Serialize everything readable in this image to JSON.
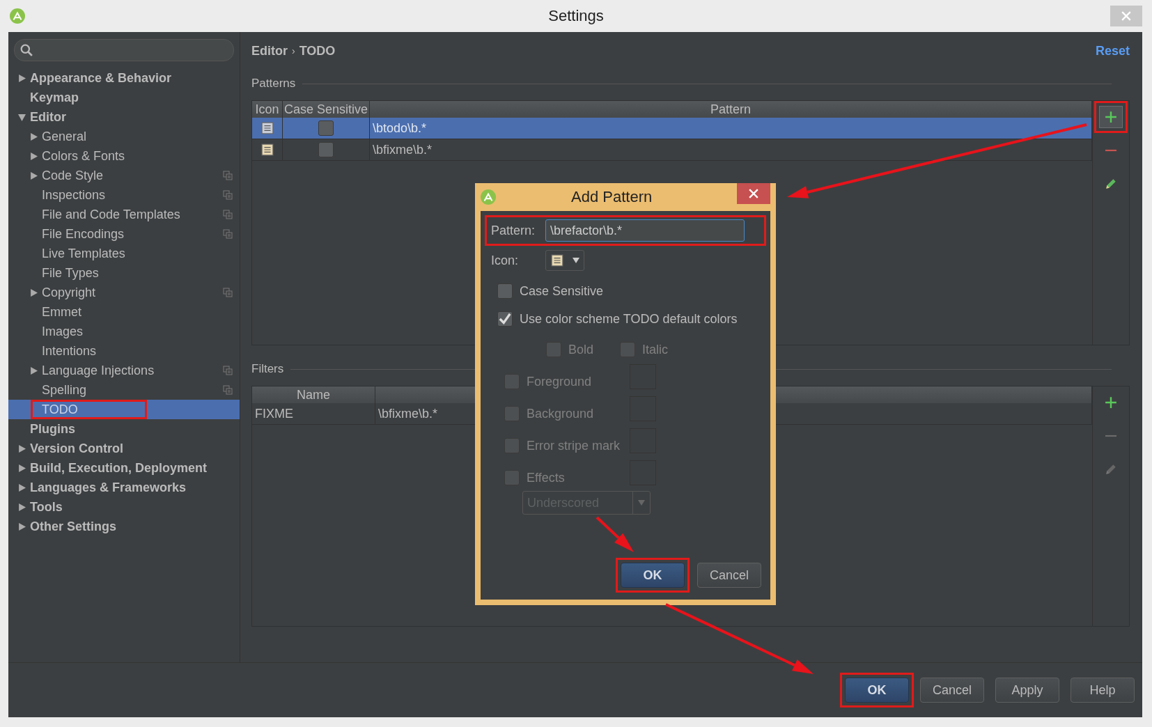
{
  "window": {
    "title": "Settings"
  },
  "sidebar": {
    "items": [
      {
        "label": "Appearance & Behavior",
        "expanded": false
      },
      {
        "label": "Keymap"
      },
      {
        "label": "Editor",
        "expanded": true,
        "children": [
          {
            "label": "General",
            "expanded": false,
            "project_level": false,
            "selected": false,
            "highlighted": false
          },
          {
            "label": "Colors & Fonts",
            "expanded": false,
            "project_level": false,
            "selected": false,
            "highlighted": false
          },
          {
            "label": "Code Style",
            "expanded": false,
            "project_level": true,
            "selected": false,
            "highlighted": false
          },
          {
            "label": "Inspections",
            "project_level": true,
            "selected": false,
            "highlighted": false
          },
          {
            "label": "File and Code Templates",
            "project_level": true,
            "selected": false,
            "highlighted": false
          },
          {
            "label": "File Encodings",
            "project_level": true,
            "selected": false,
            "highlighted": false
          },
          {
            "label": "Live Templates",
            "project_level": false,
            "selected": false,
            "highlighted": false
          },
          {
            "label": "File Types",
            "project_level": false,
            "selected": false,
            "highlighted": false
          },
          {
            "label": "Copyright",
            "expanded": false,
            "project_level": true,
            "selected": false,
            "highlighted": false
          },
          {
            "label": "Emmet",
            "project_level": false,
            "selected": false,
            "highlighted": false
          },
          {
            "label": "Images",
            "project_level": false,
            "selected": false,
            "highlighted": false
          },
          {
            "label": "Intentions",
            "project_level": false,
            "selected": false,
            "highlighted": false
          },
          {
            "label": "Language Injections",
            "expanded": false,
            "project_level": true,
            "selected": false,
            "highlighted": false
          },
          {
            "label": "Spelling",
            "project_level": true,
            "selected": false,
            "highlighted": false
          },
          {
            "label": "TODO",
            "project_level": false,
            "selected": true,
            "highlighted": true
          }
        ]
      },
      {
        "label": "Plugins"
      },
      {
        "label": "Version Control",
        "expanded": false
      },
      {
        "label": "Build, Execution, Deployment",
        "expanded": false
      },
      {
        "label": "Languages & Frameworks",
        "expanded": false
      },
      {
        "label": "Tools",
        "expanded": false
      },
      {
        "label": "Other Settings",
        "expanded": false
      }
    ]
  },
  "breadcrumb": {
    "parent": "Editor",
    "separator": "›",
    "current": "TODO"
  },
  "reset_link": "Reset",
  "patterns": {
    "title": "Patterns",
    "columns": [
      "Icon",
      "Case Sensitive",
      "Pattern"
    ],
    "rows": [
      {
        "case_sensitive": false,
        "pattern": "\\btodo\\b.*",
        "selected": true
      },
      {
        "case_sensitive": false,
        "pattern": "\\bfixme\\b.*",
        "selected": false
      }
    ],
    "toolbar": [
      {
        "kind": "add",
        "disabled": false,
        "highlighted": true
      },
      {
        "kind": "remove",
        "disabled": false,
        "highlighted": false
      },
      {
        "kind": "edit",
        "disabled": false,
        "highlighted": false
      }
    ]
  },
  "filters": {
    "title": "Filters",
    "columns": [
      "Name"
    ],
    "rows": [
      {
        "name": "FIXME",
        "column_2": "\\bfixme\\b.*"
      }
    ],
    "toolbar": [
      {
        "kind": "add",
        "disabled": false,
        "highlighted": false
      },
      {
        "kind": "remove",
        "disabled": true,
        "highlighted": false
      },
      {
        "kind": "edit",
        "disabled": true,
        "highlighted": false
      }
    ]
  },
  "dialog": {
    "title": "Add Pattern",
    "pattern": {
      "label": "Pattern:",
      "value": "\\brefactor\\b.*",
      "highlighted": true
    },
    "icon_label": "Icon:",
    "options": [
      {
        "label": "Case Sensitive",
        "checked": false,
        "disabled": false
      },
      {
        "label": "Use color scheme TODO default colors",
        "checked": true,
        "disabled": false
      }
    ],
    "font_styles": [
      {
        "label": "Bold",
        "checked": false,
        "disabled": true
      },
      {
        "label": "Italic",
        "checked": false,
        "disabled": true
      }
    ],
    "color_options": [
      {
        "label": "Foreground",
        "checked": false,
        "disabled": true
      },
      {
        "label": "Background",
        "checked": false,
        "disabled": true
      },
      {
        "label": "Error stripe mark",
        "checked": false,
        "disabled": true
      },
      {
        "label": "Effects",
        "checked": false,
        "disabled": true
      }
    ],
    "effect_dropdown": {
      "value": "Underscored",
      "disabled": true
    },
    "buttons": [
      {
        "label": "OK",
        "default": true,
        "highlighted": true
      },
      {
        "label": "Cancel",
        "default": false,
        "highlighted": false
      }
    ]
  },
  "buttons": [
    {
      "label": "OK",
      "default": true,
      "highlighted": true
    },
    {
      "label": "Cancel",
      "default": false,
      "highlighted": false
    },
    {
      "label": "Apply",
      "default": false,
      "highlighted": false
    },
    {
      "label": "Help",
      "default": false,
      "highlighted": false
    }
  ]
}
